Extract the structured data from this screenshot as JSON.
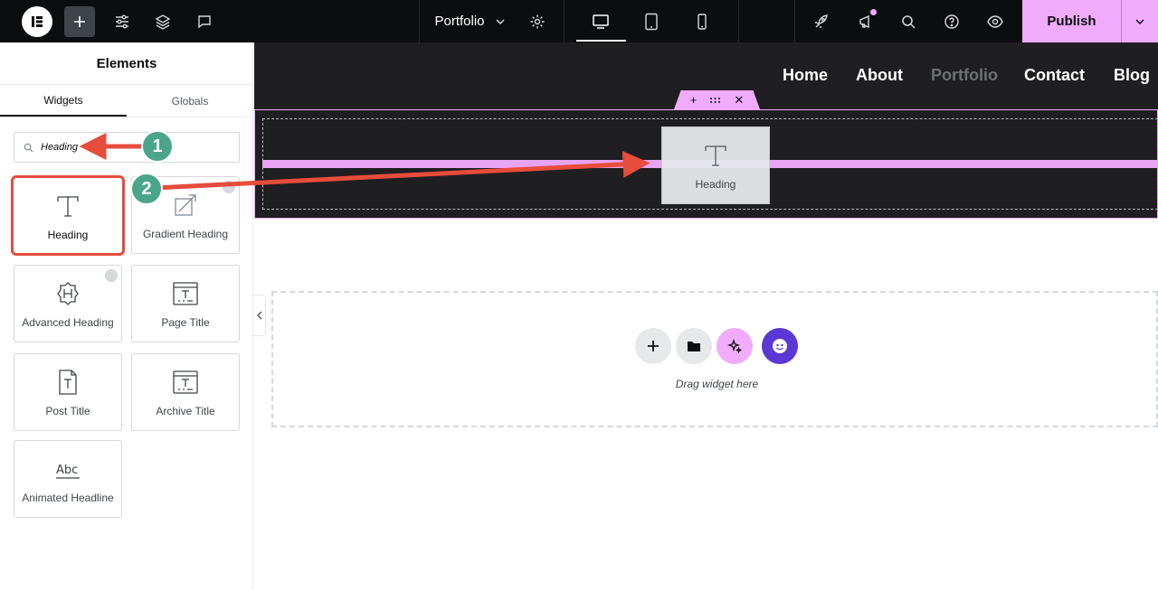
{
  "topbar": {
    "page_name": "Portfolio",
    "publish_label": "Publish",
    "accent_color": "#f0abfc"
  },
  "panel": {
    "title": "Elements",
    "tabs": [
      {
        "label": "Widgets",
        "active": true
      },
      {
        "label": "Globals",
        "active": false
      }
    ],
    "search_value": "Heading",
    "widgets": [
      {
        "label": "Heading",
        "icon": "heading-t-icon"
      },
      {
        "label": "Gradient Heading",
        "icon": "gradient-heading-icon"
      },
      {
        "label": "Advanced Heading",
        "icon": "advanced-heading-icon"
      },
      {
        "label": "Page Title",
        "icon": "page-title-icon"
      },
      {
        "label": "Post Title",
        "icon": "post-title-icon"
      },
      {
        "label": "Archive Title",
        "icon": "archive-title-icon"
      },
      {
        "label": "Animated Headline",
        "icon": "animated-headline-icon"
      }
    ]
  },
  "canvas": {
    "nav": [
      "Home",
      "About",
      "Portfolio",
      "Contact",
      "Blog"
    ],
    "drag_ghost_label": "Heading",
    "drag_widget_text": "Drag widget here"
  },
  "annotations": {
    "steps": [
      "1",
      "2"
    ],
    "arrow_color": "#e74c3c",
    "badge_color": "#4aa58b"
  }
}
